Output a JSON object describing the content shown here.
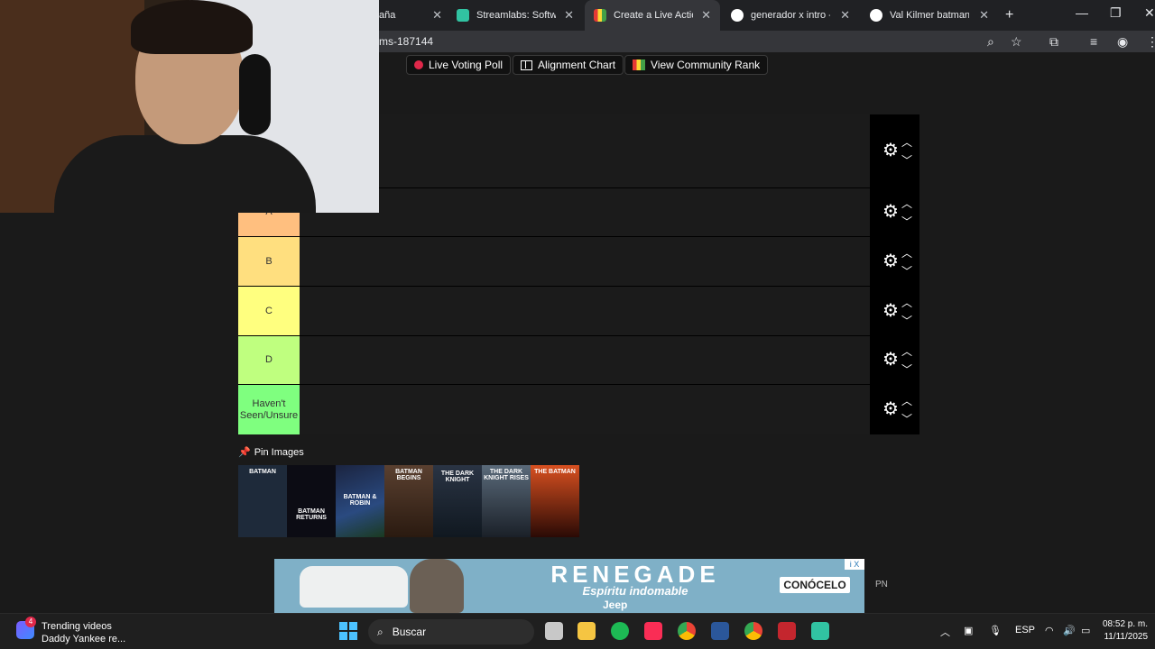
{
  "browser": {
    "tabs": [
      {
        "title": "aña",
        "favicon_color": "#5f6368"
      },
      {
        "title": "Streamlabs: Software",
        "favicon_color": "#31c3a2"
      },
      {
        "title": "Create a Live Action",
        "favicon_color": "#7a7a7a"
      },
      {
        "title": "generador x intro - B",
        "favicon_color": "#4285f4"
      },
      {
        "title": "Val Kilmer batman -",
        "favicon_color": "#4285f4"
      }
    ],
    "url": "ms-187144"
  },
  "toolbar": {
    "live_voting": "Live Voting Poll",
    "alignment_chart": "Alignment Chart",
    "community_rank": "View Community Rank"
  },
  "tiers": [
    {
      "label": "",
      "color": "#ff7f7f"
    },
    {
      "label": "A",
      "color": "#ffbf7f"
    },
    {
      "label": "B",
      "color": "#ffdf7f"
    },
    {
      "label": "C",
      "color": "#ffff7f"
    },
    {
      "label": "D",
      "color": "#bfff7f"
    },
    {
      "label": "Haven't Seen/Unsure",
      "color": "#7fff7f"
    }
  ],
  "pin_label": "Pin Images",
  "posters": [
    {
      "caption": "BATMAN",
      "color": "#1e2a3a"
    },
    {
      "caption": "BATMAN RETURNS",
      "color": "#0c0c14"
    },
    {
      "caption": "BATMAN & ROBIN",
      "color": "#1b2440"
    },
    {
      "caption": "BATMAN BEGINS",
      "color": "#3a2a1a"
    },
    {
      "caption": "THE DARK KNIGHT",
      "color": "#1a2232"
    },
    {
      "caption": "THE DARK KNIGHT RISES",
      "color": "#283848"
    },
    {
      "caption": "THE BATMAN",
      "color": "#a8301a"
    }
  ],
  "ad": {
    "brand": "RENEGADE",
    "slogan": "Espíritu indomable",
    "jeep": "Jeep",
    "cta": "CONÓCELO",
    "badge": "i X",
    "side": "PN"
  },
  "taskbar": {
    "widget_title": "Trending videos",
    "widget_sub": "Daddy Yankee re...",
    "widget_badge": "4",
    "search": "Buscar",
    "lang": "ESP",
    "time": "08:52 p. m.",
    "date": "11/11/2025"
  }
}
